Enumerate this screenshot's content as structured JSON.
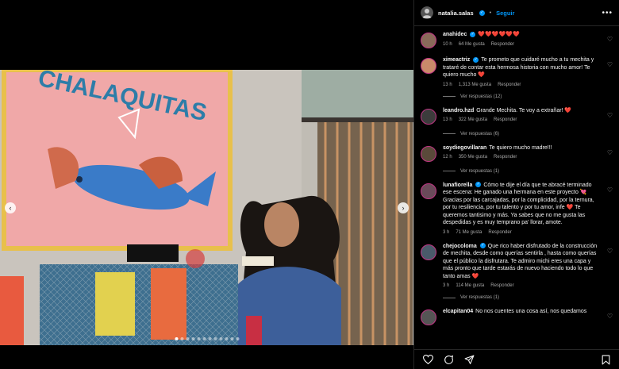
{
  "post": {
    "username": "natalia.salas",
    "follow_label": "Seguir",
    "more_icon": "more-horizontal-icon"
  },
  "media": {
    "mural_text": "CHALAQUITAS",
    "total_slides": 12,
    "current_slide": 1
  },
  "comments": [
    {
      "username": "anahidec",
      "verified": true,
      "text": "❤️❤️❤️❤️❤️❤️",
      "time": "10 h",
      "likes": "64 Me gusta",
      "reply": "Responder",
      "view_replies": ""
    },
    {
      "username": "ximeactriz",
      "verified": true,
      "text": "Te prometo que cuidaré mucho a tu mechita y trataré de contar esta hermosa historia con mucho amor! Te quiero mucho ❤️",
      "time": "13 h",
      "likes": "1,313 Me gusta",
      "reply": "Responder",
      "view_replies": "Ver respuestas (12)"
    },
    {
      "username": "leandro.hzd",
      "verified": false,
      "text": "Grande Mechita. Te voy a extrañar! ❤️",
      "time": "13 h",
      "likes": "322 Me gusta",
      "reply": "Responder",
      "view_replies": "Ver respuestas (6)"
    },
    {
      "username": "soydiegovillaran",
      "verified": false,
      "text": "Te quiero mucho madre!!!",
      "time": "12 h",
      "likes": "350 Me gusta",
      "reply": "Responder",
      "view_replies": "Ver respuestas (1)"
    },
    {
      "username": "lunafiorella",
      "verified": true,
      "text": "Cómo te dije el día que te abracé terminado ese escena: He ganado una hermana en este proyecto 💘 Gracias por las carcajadas, por la complicidad, por la ternura, por tu resiliencia, por tu talento y por tu amor, infe ❤️ Te queremos tantisimo y más. Ya sabes que no me gusta las despedidas y es muy temprano pa' llorar, amote.",
      "time": "3 h",
      "likes": "71 Me gusta",
      "reply": "Responder",
      "view_replies": ""
    },
    {
      "username": "chejocoloma",
      "verified": true,
      "text": "Que rico haber disfrutado de la construcción de mechita, desde como querías sentirla , hasta como querías que el público la disfrutara. Te admiro michi eres una capa y más pronto que tarde estarás de nuevo haciendo todo lo que tanto amas ❤️",
      "time": "3 h",
      "likes": "114 Me gusta",
      "reply": "Responder",
      "view_replies": "Ver respuestas (1)"
    },
    {
      "username": "elcapitan04",
      "verified": false,
      "text": "No nos cuentes una cosa así, nos quedamos",
      "time": "",
      "likes": "",
      "reply": "",
      "view_replies": ""
    }
  ],
  "actions": {
    "like_icon": "heart-icon",
    "comment_icon": "comment-icon",
    "share_icon": "share-icon",
    "save_icon": "bookmark-icon"
  },
  "colors": {
    "accent": "#0095f6",
    "heart": "#ff3b8d",
    "background": "#000000"
  }
}
